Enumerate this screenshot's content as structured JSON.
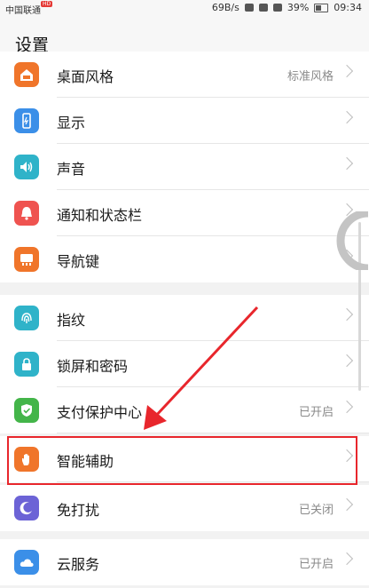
{
  "statusbar": {
    "carrier": "中国联通",
    "carrier_badge": "HD",
    "speed": "69B/s",
    "battery": "39%",
    "time": "09:34"
  },
  "header": {
    "title": "设置"
  },
  "rows": [
    {
      "label": "桌面风格",
      "value": "标准风格",
      "icon": "home-style-icon",
      "color": "#f0752a"
    },
    {
      "label": "显示",
      "value": "",
      "icon": "display-icon",
      "color": "#3b8fe8"
    },
    {
      "label": "声音",
      "value": "",
      "icon": "speaker-icon",
      "color": "#2fb3c9"
    },
    {
      "label": "通知和状态栏",
      "value": "",
      "icon": "bell-icon",
      "color": "#ef5350"
    },
    {
      "label": "导航键",
      "value": "",
      "icon": "navigation-key-icon",
      "color": "#f0752a"
    },
    {
      "label": "指纹",
      "value": "",
      "icon": "fingerprint-icon",
      "color": "#2fb3c9"
    },
    {
      "label": "锁屏和密码",
      "value": "",
      "icon": "lock-icon",
      "color": "#2fb3c9"
    },
    {
      "label": "支付保护中心",
      "value": "已开启",
      "icon": "shield-check-icon",
      "color": "#43b549"
    },
    {
      "label": "智能辅助",
      "value": "",
      "icon": "hand-icon",
      "color": "#f0752a"
    },
    {
      "label": "免打扰",
      "value": "已关闭",
      "icon": "moon-icon",
      "color": "#6c63d6"
    },
    {
      "label": "云服务",
      "value": "已开启",
      "icon": "cloud-icon",
      "color": "#3b8fe8"
    }
  ],
  "annotation": {
    "color": "#e8262c"
  }
}
